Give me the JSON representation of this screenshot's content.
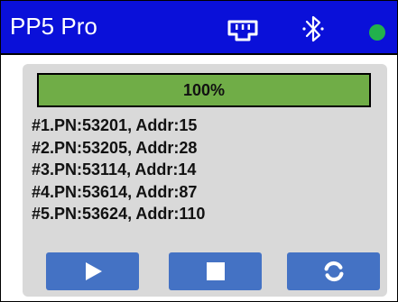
{
  "header": {
    "title": "PP5 Pro",
    "icons": [
      "ethernet-icon",
      "bluetooth-icon"
    ],
    "status_color": "#22b14c"
  },
  "colors": {
    "title_bar": "#0a10d9",
    "panel": "#d9d9d9",
    "progress_fill": "#70ad47",
    "button": "#4472c4"
  },
  "progress": {
    "label": "100%",
    "value": 100
  },
  "devices": [
    "#1.PN:53201, Addr:15",
    "#2.PN:53205, Addr:28",
    "#3.PN:53114, Addr:14",
    "#4.PN:53614, Addr:87",
    "#5.PN:53624, Addr:110"
  ],
  "buttons": {
    "play_icon": "play-icon",
    "stop_icon": "stop-icon",
    "refresh_icon": "refresh-icon"
  }
}
